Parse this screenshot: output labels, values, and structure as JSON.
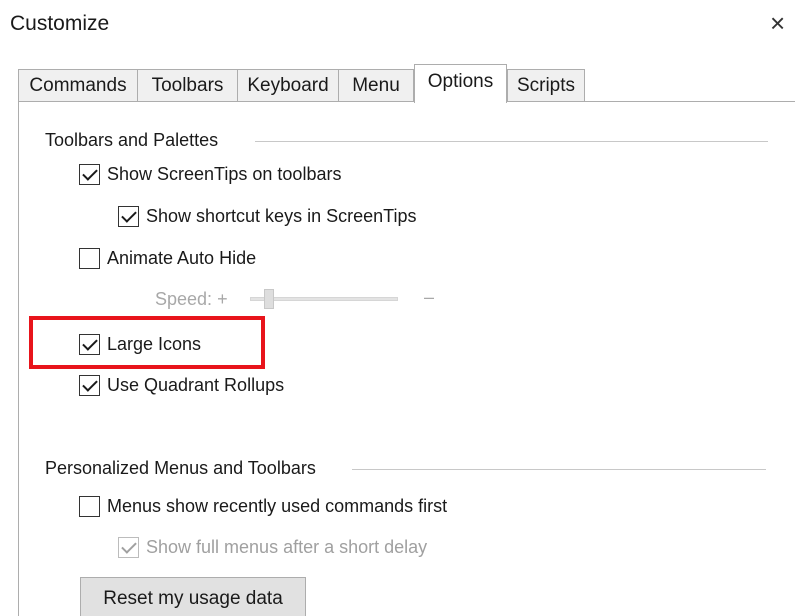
{
  "window": {
    "title": "Customize",
    "close_symbol": "×"
  },
  "tabs": [
    {
      "label": "Commands",
      "active": false
    },
    {
      "label": "Toolbars",
      "active": false
    },
    {
      "label": "Keyboard",
      "active": false
    },
    {
      "label": "Menu",
      "active": false
    },
    {
      "label": "Options",
      "active": true
    },
    {
      "label": "Scripts",
      "active": false
    }
  ],
  "toolbars_palettes": {
    "heading": "Toolbars and Palettes",
    "show_screentips": {
      "label": "Show ScreenTips on toolbars",
      "checked": true
    },
    "show_shortcut_keys": {
      "label": "Show shortcut keys in ScreenTips",
      "checked": true
    },
    "animate_auto_hide": {
      "label": "Animate Auto Hide",
      "checked": false
    },
    "speed": {
      "label": "Speed:",
      "plus": "+",
      "minus": "–",
      "level": 0.1,
      "enabled": false
    },
    "large_icons": {
      "label": "Large Icons",
      "checked": true
    },
    "quadrant_rollups": {
      "label": "Use Quadrant Rollups",
      "checked": true
    }
  },
  "personalized_menus": {
    "heading": "Personalized Menus and Toolbars",
    "recent_commands_first": {
      "label": "Menus show recently used commands first",
      "checked": false
    },
    "full_menus_delay": {
      "label": "Show full menus after a short delay",
      "checked": true,
      "enabled": false
    },
    "reset_button": "Reset my usage data"
  },
  "colors": {
    "highlight": "#e8141b",
    "disabled_text": "#a0a0a0"
  }
}
